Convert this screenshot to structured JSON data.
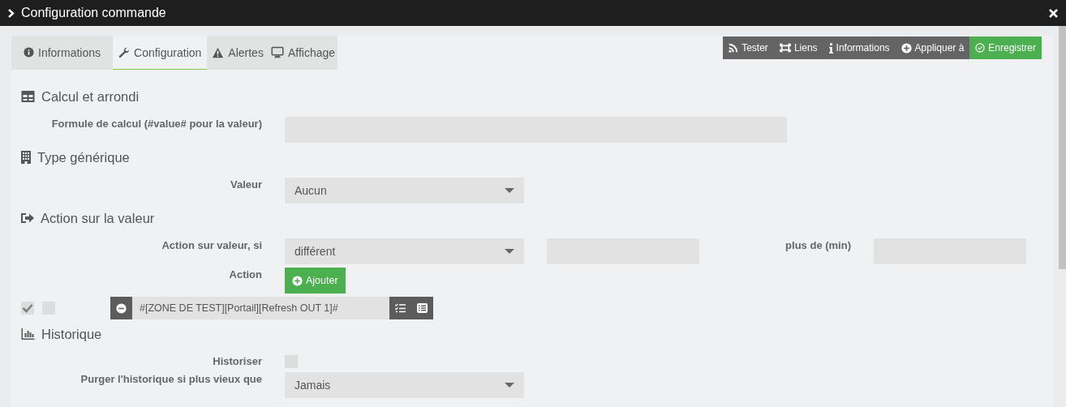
{
  "window": {
    "title": "Configuration commande"
  },
  "tabs": [
    {
      "label": "Informations",
      "selected": false
    },
    {
      "label": "Configuration",
      "selected": true
    },
    {
      "label": "Alertes",
      "selected": false
    },
    {
      "label": "Affichage",
      "selected": false
    }
  ],
  "toolbar": [
    {
      "label": "Tester",
      "kind": "default"
    },
    {
      "label": "Liens",
      "kind": "default"
    },
    {
      "label": "Informations",
      "kind": "default"
    },
    {
      "label": "Appliquer à",
      "kind": "default"
    },
    {
      "label": "Enregistrer",
      "kind": "success"
    }
  ],
  "sections": [
    {
      "title": "Calcul et arrondi",
      "rows": [
        {
          "kind": "text",
          "label": "Formule de calcul (#value# pour la valeur)"
        }
      ]
    },
    {
      "title": "Type générique",
      "rows": [
        {
          "kind": "select",
          "label": "Valeur",
          "value": "Aucun"
        }
      ]
    },
    {
      "title": "Action sur la valeur",
      "rows": [
        {
          "kind": "condition",
          "label": "Action sur valeur, si",
          "value": "différent",
          "extra_label": "plus de (min)"
        },
        {
          "kind": "button",
          "label": "Action",
          "button": "Ajouter"
        },
        {
          "kind": "action",
          "enabled": true,
          "option": false,
          "value": "#[ZONE DE TEST][Portail][Refresh OUT 1]#"
        }
      ]
    },
    {
      "title": "Historique",
      "rows": [
        {
          "kind": "checkbox",
          "label": "Historiser",
          "checked": false
        },
        {
          "kind": "select",
          "label": "Purger l'historique si plus vieux que",
          "value": "Jamais"
        }
      ]
    }
  ]
}
